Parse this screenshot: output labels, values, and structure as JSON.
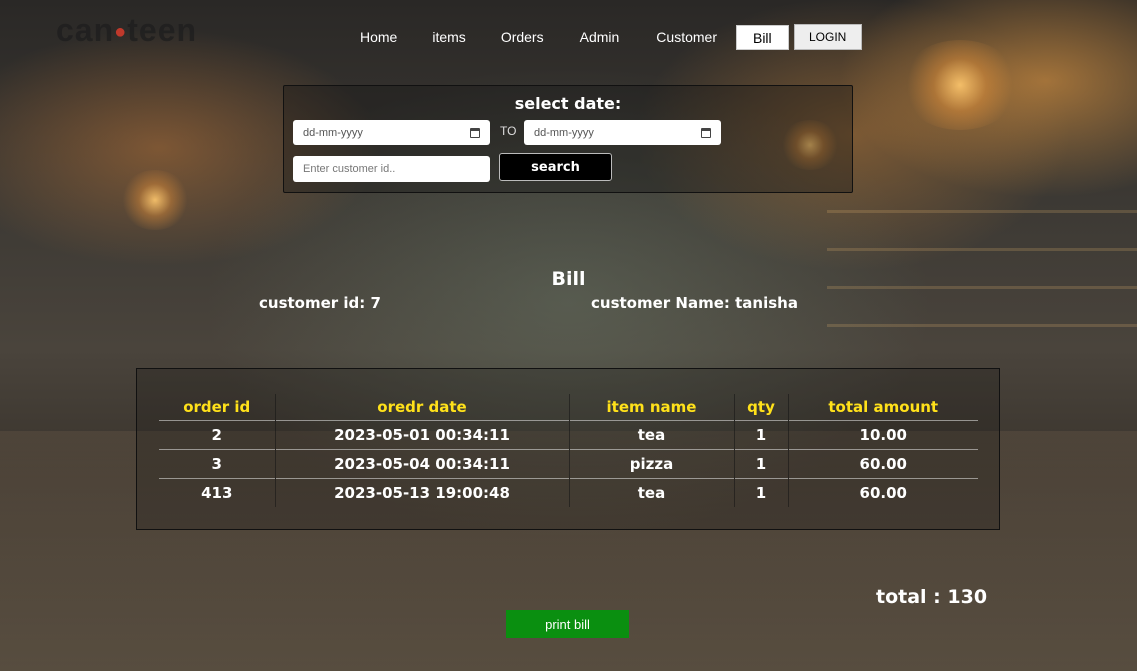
{
  "brand": {
    "logo_text_a": "can",
    "logo_text_b": "teen"
  },
  "nav": {
    "items": [
      "Home",
      "items",
      "Orders",
      "Admin",
      "Customer"
    ],
    "bill_label": "Bill",
    "login_label": "LOGIN"
  },
  "search": {
    "title": "select date:",
    "from_placeholder": "dd-mm-yyyy",
    "to_label": "TO",
    "to_placeholder": "dd-mm-yyyy",
    "customer_placeholder": "Enter customer id..",
    "button_label": "search"
  },
  "bill": {
    "title": "Bill",
    "customer_id_text": "customer id: 7",
    "customer_name_text": "customer Name: tanisha"
  },
  "table": {
    "headers": [
      "order id",
      "oredr date",
      "item name",
      "qty",
      "total amount"
    ],
    "rows": [
      [
        "2",
        "2023-05-01 00:34:11",
        "tea",
        "1",
        "10.00"
      ],
      [
        "3",
        "2023-05-04 00:34:11",
        "pizza",
        "1",
        "60.00"
      ],
      [
        "413",
        "2023-05-13 19:00:48",
        "tea",
        "1",
        "60.00"
      ]
    ]
  },
  "summary": {
    "total_text": "total : 130"
  },
  "actions": {
    "print_label": "print bill"
  },
  "colors": {
    "header_accent": "#ffe11a",
    "print_button": "#0a8f10"
  }
}
